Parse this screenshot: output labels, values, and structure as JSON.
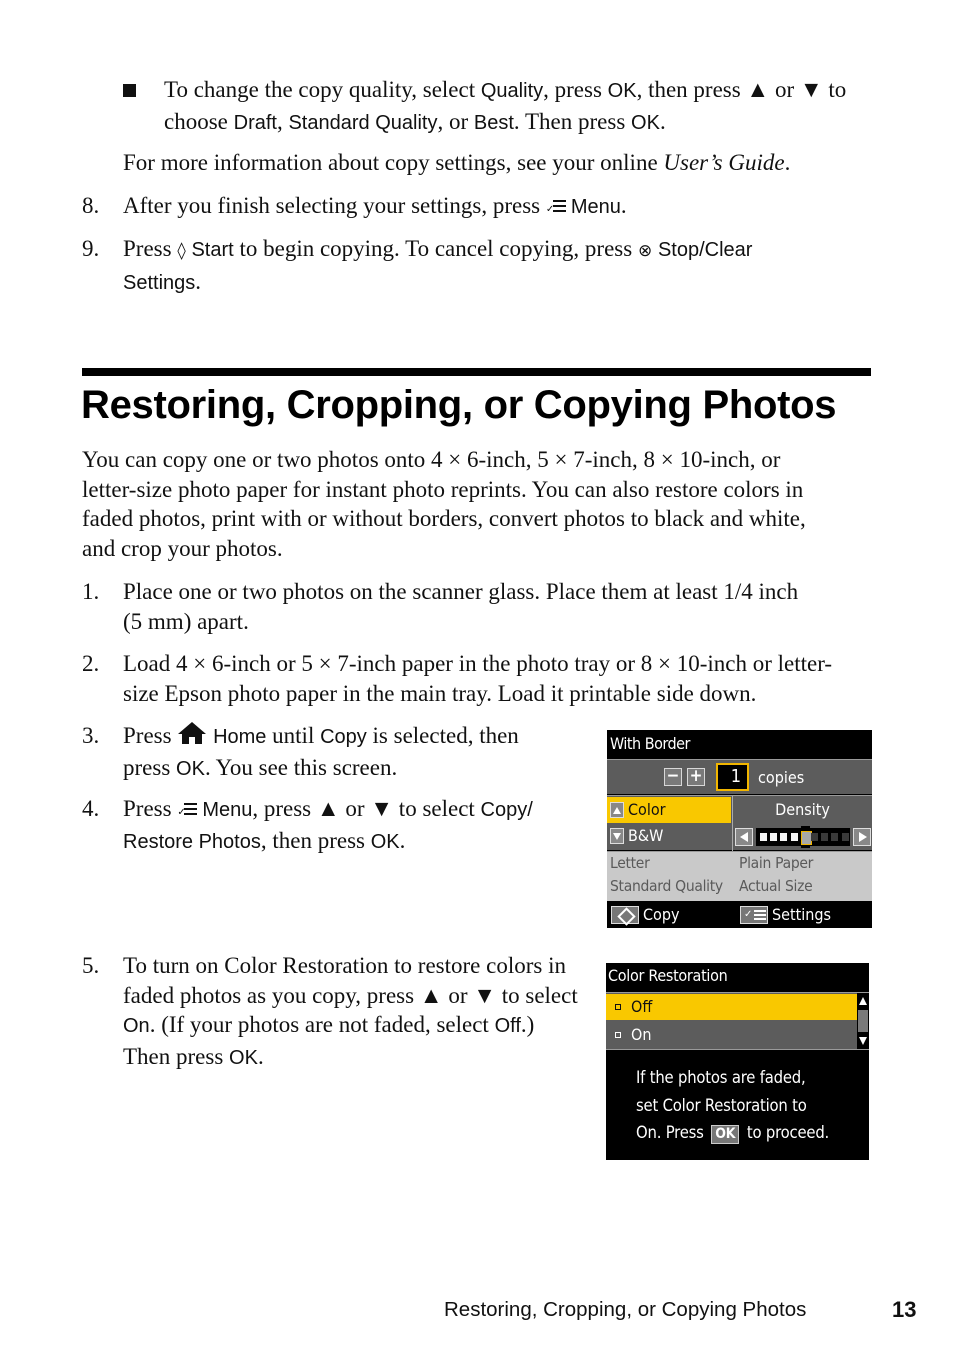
{
  "bullet_item": {
    "t1": "To change the copy quality, select ",
    "k1": "Quality",
    "t2": ", press ",
    "k2": "OK",
    "t3": ", then press ▲ or ▼ to",
    "t4": "choose ",
    "k3": "Draft",
    "t5": ", ",
    "k4": "Standard Quality",
    "t6": ", or ",
    "k5": "Best",
    "t7": ". Then press ",
    "k6": "OK",
    "t8": "."
  },
  "more_info": {
    "text": "For more information about copy settings, see your online ",
    "guide": "User’s Guide",
    "end": "."
  },
  "steps_top": [
    {
      "num": "8.",
      "t1": "After you finish selecting your settings, press ",
      "k1": "Menu",
      "t2": "."
    },
    {
      "num": "9.",
      "t1": "Press ",
      "icon1": "◊",
      "k1": "Start",
      "t2": " to begin copying. To cancel copying, press ",
      "icon2": "⊗",
      "k2": "Stop/Clear",
      "k3": "Settings",
      "t3": "."
    }
  ],
  "section": {
    "title": "Restoring, Cropping, or Copying Photos",
    "intro_lines": [
      "You can copy one or two photos onto 4 × 6-inch, 5 × 7-inch, 8 × 10-inch, or",
      "letter-size photo paper for instant photo reprints. You can also restore colors in",
      "faded photos, print with or without borders, convert photos to black and white,",
      "and crop your photos."
    ]
  },
  "steps": [
    {
      "num": "1.",
      "lines": [
        "Place one or two photos on the scanner glass. Place them at least 1/4 inch",
        "(5 mm) apart."
      ]
    },
    {
      "num": "2.",
      "lines": [
        "Load 4 × 6-inch or 5 × 7-inch paper in the photo tray or 8 × 10-inch or letter-",
        "size Epson photo paper in the main tray. Load it printable side down."
      ]
    },
    {
      "num": "3.",
      "t1": "Press ",
      "k1": "Home",
      "t2": " until ",
      "k2": "Copy",
      "t3": " is selected, then",
      "t4": "press ",
      "k3": "OK",
      "t5": ". You see this screen."
    },
    {
      "num": "4.",
      "t1": "Press ",
      "k1": "Menu",
      "t2": ", press ▲ or ▼ to select ",
      "k2": "Copy/",
      "k3": "Restore Photos",
      "t3": ", then press ",
      "k4": "OK",
      "t4": "."
    },
    {
      "num": "5.",
      "l1": "To turn on Color Restoration to restore colors in",
      "l2": "faded photos as you copy, press ▲ or ▼ to select",
      "k1": "On",
      "t1": ". (If your photos are not faded, select ",
      "k2": "Off",
      "t2": ".)",
      "t3": "Then press ",
      "k3": "OK",
      "t4": "."
    }
  ],
  "lcd_copy": {
    "title": "With Border",
    "minus": "−",
    "plus": "+",
    "copies_value": "1",
    "copies_label": "copies",
    "options": [
      {
        "label": "Color",
        "selected": true
      },
      {
        "label": "B&W",
        "selected": false
      }
    ],
    "density_label": "Density",
    "density_level": 5,
    "density_steps": 9,
    "info": {
      "paper_size": "Letter",
      "paper_type": "Plain Paper",
      "quality": "Standard Quality",
      "size": "Actual Size"
    },
    "footer": {
      "copy": "Copy",
      "settings": "Settings"
    },
    "colors": {
      "highlight": "#f9c800",
      "frame": "#f2b600",
      "panel": "#5c5c5c",
      "info_bg": "#c9c9c9"
    }
  },
  "lcd_restore": {
    "title": "Color Restoration",
    "options": [
      {
        "label": "Off",
        "selected": true
      },
      {
        "label": "On",
        "selected": false
      }
    ],
    "message_lines": [
      "If the photos are faded,",
      "set Color Restoration to"
    ],
    "message_l3a": "On. Press",
    "ok_label": "OK",
    "message_l3b": "to proceed."
  },
  "footer": {
    "running_title": "Restoring, Cropping, or Copying Photos",
    "page_number": "13"
  }
}
